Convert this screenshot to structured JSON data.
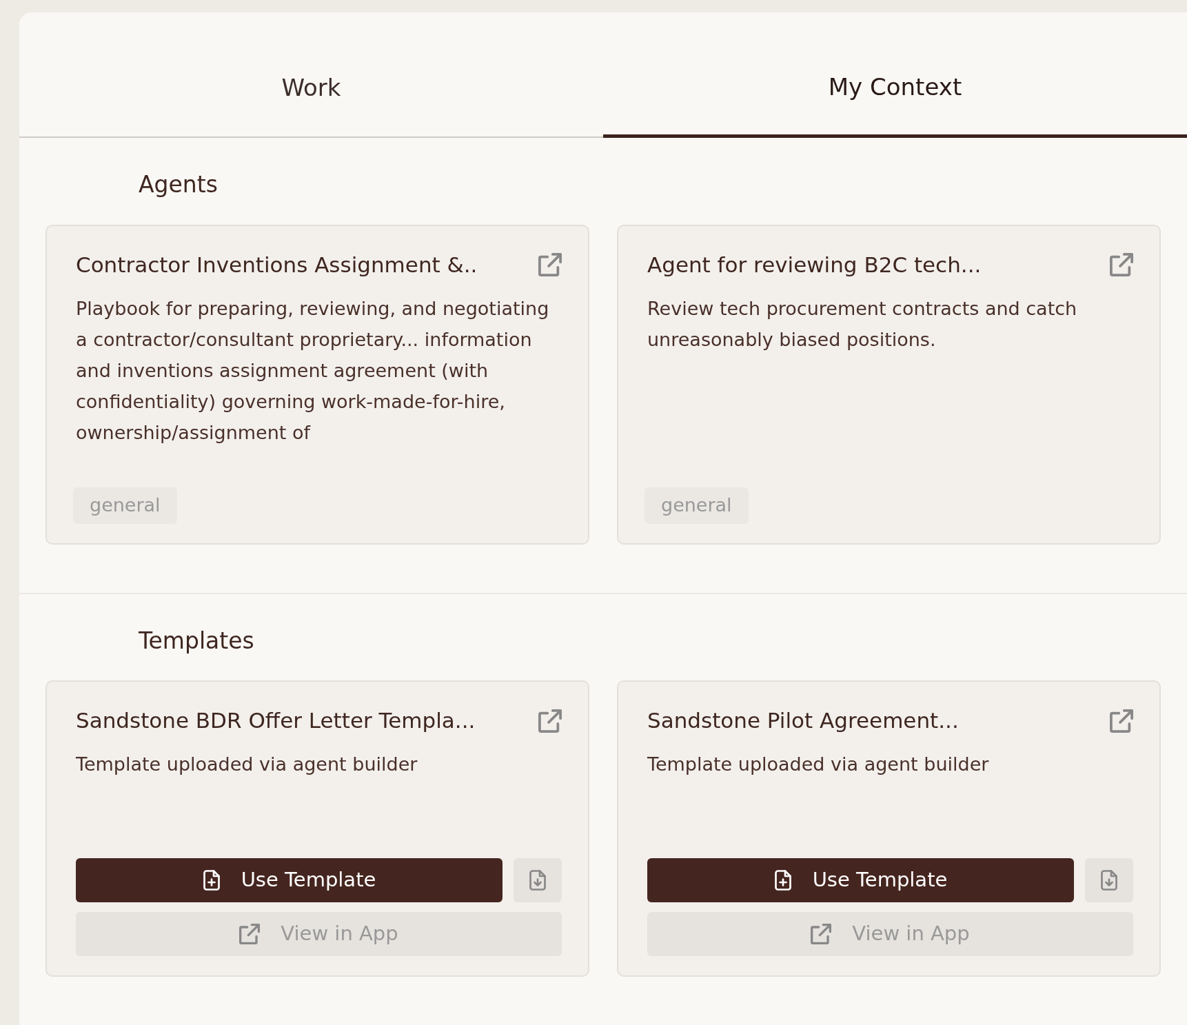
{
  "tabs": [
    {
      "label": "Work",
      "selected": false
    },
    {
      "label": "My Context",
      "selected": true
    }
  ],
  "sections": [
    {
      "title": "Agents",
      "kind": "agents",
      "cards": [
        {
          "title": "Contractor Inventions Assignment &..",
          "description": "Playbook for preparing, reviewing, and negotiating a contractor/consultant proprietary... information and inventions assignment agreement (with confidentiality) governing work-made-for-hire, ownership/assignment of",
          "tag": "general"
        },
        {
          "title": "Agent for reviewing B2C tech...",
          "description": "Review tech procurement contracts and catch unreasonably biased positions.",
          "tag": "general"
        }
      ]
    },
    {
      "title": "Templates",
      "kind": "templates",
      "cards": [
        {
          "title": "Sandstone BDR Offer Letter Templa...",
          "description": "Template uploaded via agent builder",
          "primary_button": "Use Template",
          "secondary_button": "View in App"
        },
        {
          "title": "Sandstone Pilot Agreement...",
          "description": "Template uploaded via agent builder",
          "primary_button": "Use Template",
          "secondary_button": "View in App"
        }
      ]
    }
  ]
}
